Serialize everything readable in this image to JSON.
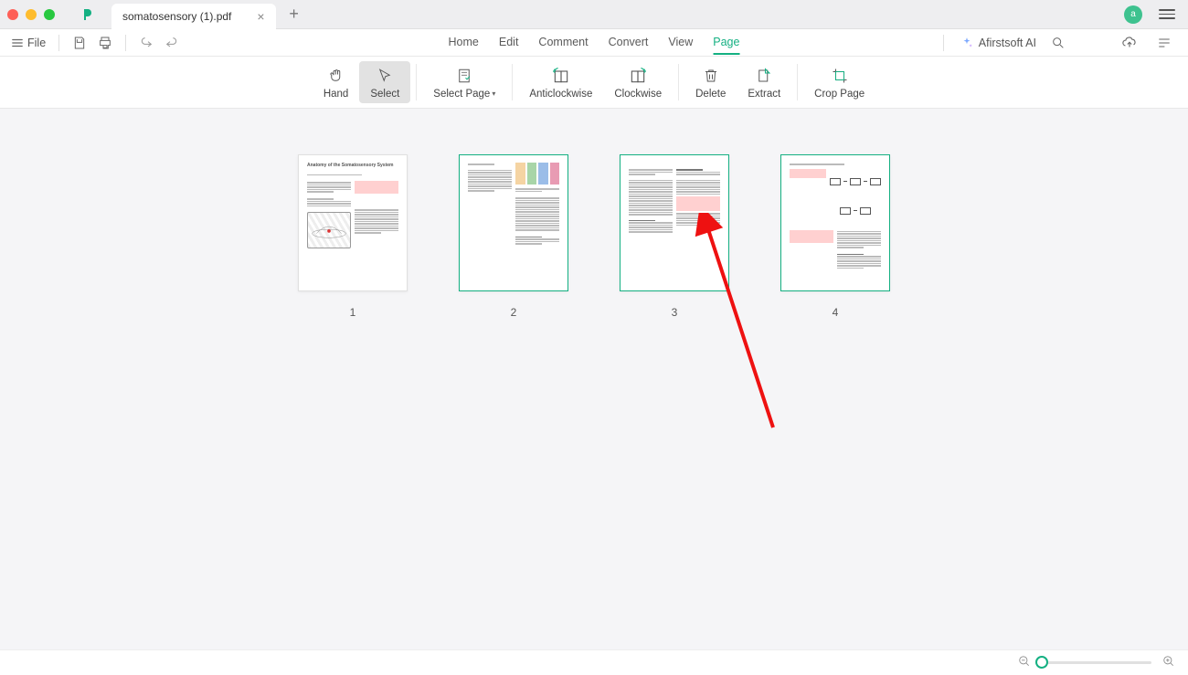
{
  "tab": {
    "title": "somatosensory (1).pdf"
  },
  "avatar_letter": "a",
  "file_menu_label": "File",
  "menu_tabs": {
    "home": "Home",
    "edit": "Edit",
    "comment": "Comment",
    "convert": "Convert",
    "view": "View",
    "page": "Page"
  },
  "active_menu_tab": "page",
  "ai_label": "Afirstsoft AI",
  "ribbon": {
    "hand": "Hand",
    "select": "Select",
    "select_page": "Select Page",
    "anticlockwise": "Anticlockwise",
    "clockwise": "Clockwise",
    "delete": "Delete",
    "extract": "Extract",
    "crop_page": "Crop Page"
  },
  "pages": {
    "p1": "1",
    "p2": "2",
    "p3": "3",
    "p4": "4"
  },
  "page1_title": "Anatomy of the Somatosensory System",
  "selected_pages": [
    2,
    3,
    4
  ]
}
